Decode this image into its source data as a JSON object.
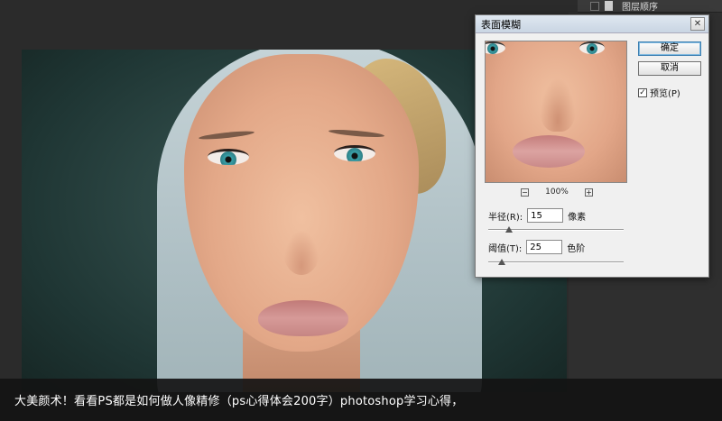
{
  "layers_panel": {
    "label": "图层顺序"
  },
  "dialog": {
    "title": "表面模糊",
    "close_glyph": "✕",
    "ok_label": "确定",
    "cancel_label": "取消",
    "preview_label": "预览(P)",
    "preview_checked": true,
    "zoom_level": "100%",
    "zoom_out_glyph": "−",
    "zoom_in_glyph": "+",
    "radius": {
      "label": "半径(R):",
      "value": "15",
      "unit": "像素",
      "slider_fraction": 0.15
    },
    "threshold": {
      "label": "阈值(T):",
      "value": "25",
      "unit": "色阶",
      "slider_fraction": 0.1
    }
  },
  "caption": "大美颜术！看看PS都是如何做人像精修（ps心得体会200字）photoshop学习心得，",
  "colors": {
    "canvas_bg": "#1f3634",
    "dialog_bg": "#f0f0f0",
    "app_bg": "#2b2b2b",
    "primary_button_border": "#3c7fb1"
  }
}
